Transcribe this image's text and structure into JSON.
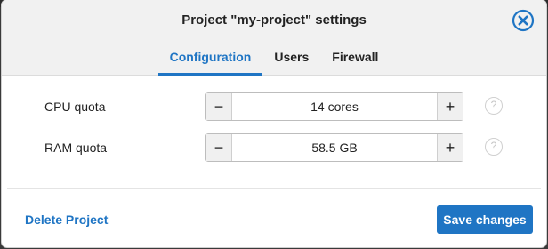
{
  "dialog": {
    "title": "Project \"my-project\" settings",
    "accent_color": "#1f75c4"
  },
  "tabs": [
    {
      "label": "Configuration",
      "active": true
    },
    {
      "label": "Users",
      "active": false
    },
    {
      "label": "Firewall",
      "active": false
    }
  ],
  "fields": {
    "cpu": {
      "label": "CPU quota",
      "value": "14 cores",
      "decrement": "−",
      "increment": "+",
      "help": "?"
    },
    "ram": {
      "label": "RAM quota",
      "value": "58.5 GB",
      "decrement": "−",
      "increment": "+",
      "help": "?"
    }
  },
  "footer": {
    "delete_label": "Delete Project",
    "save_label": "Save changes"
  },
  "icons": {
    "close": "close-icon"
  }
}
